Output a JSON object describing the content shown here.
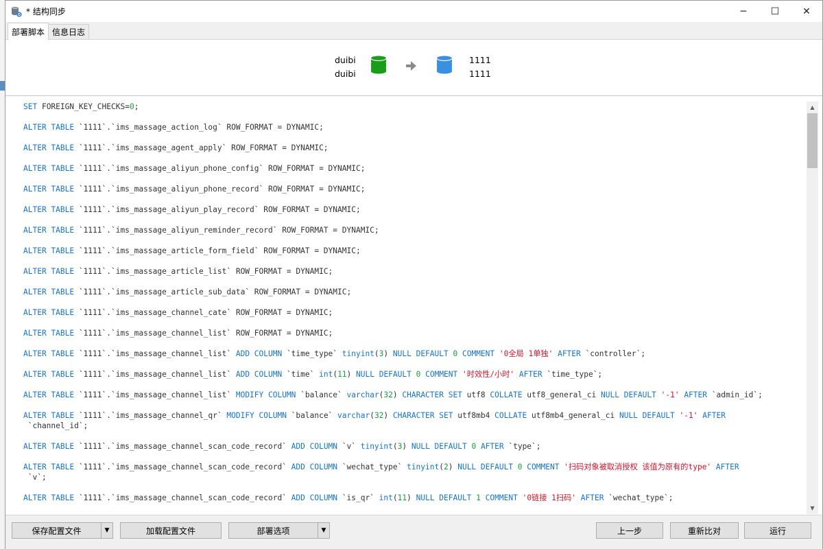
{
  "window": {
    "title": "* 结构同步",
    "icon": "database-sync-icon",
    "minimize_icon": "─",
    "maximize_icon": "☐",
    "close_icon": "✕"
  },
  "tabs": [
    {
      "label": "部署脚本",
      "active": true
    },
    {
      "label": "信息日志",
      "active": false
    }
  ],
  "header": {
    "source_connection": "duibi",
    "source_database": "duibi",
    "target_connection": "1111",
    "target_database": "1111",
    "source_color": "#1a9e1a",
    "target_color": "#3b8fe0"
  },
  "script_lines": [
    [
      {
        "t": "SET",
        "k": "kw"
      },
      {
        "t": " FOREIGN_KEY_CHECKS="
      },
      {
        "t": "0",
        "k": "num"
      },
      {
        "t": ";"
      }
    ],
    [
      {
        "t": "ALTER TABLE",
        "k": "kw"
      },
      {
        "t": " `1111`.`ims_massage_action_log` ROW_FORMAT = DYNAMIC;"
      }
    ],
    [
      {
        "t": "ALTER TABLE",
        "k": "kw"
      },
      {
        "t": " `1111`.`ims_massage_agent_apply` ROW_FORMAT = DYNAMIC;"
      }
    ],
    [
      {
        "t": "ALTER TABLE",
        "k": "kw"
      },
      {
        "t": " `1111`.`ims_massage_aliyun_phone_config` ROW_FORMAT = DYNAMIC;"
      }
    ],
    [
      {
        "t": "ALTER TABLE",
        "k": "kw"
      },
      {
        "t": " `1111`.`ims_massage_aliyun_phone_record` ROW_FORMAT = DYNAMIC;"
      }
    ],
    [
      {
        "t": "ALTER TABLE",
        "k": "kw"
      },
      {
        "t": " `1111`.`ims_massage_aliyun_play_record` ROW_FORMAT = DYNAMIC;"
      }
    ],
    [
      {
        "t": "ALTER TABLE",
        "k": "kw"
      },
      {
        "t": " `1111`.`ims_massage_aliyun_reminder_record` ROW_FORMAT = DYNAMIC;"
      }
    ],
    [
      {
        "t": "ALTER TABLE",
        "k": "kw"
      },
      {
        "t": " `1111`.`ims_massage_article_form_field` ROW_FORMAT = DYNAMIC;"
      }
    ],
    [
      {
        "t": "ALTER TABLE",
        "k": "kw"
      },
      {
        "t": " `1111`.`ims_massage_article_list` ROW_FORMAT = DYNAMIC;"
      }
    ],
    [
      {
        "t": "ALTER TABLE",
        "k": "kw"
      },
      {
        "t": " `1111`.`ims_massage_article_sub_data` ROW_FORMAT = DYNAMIC;"
      }
    ],
    [
      {
        "t": "ALTER TABLE",
        "k": "kw"
      },
      {
        "t": " `1111`.`ims_massage_channel_cate` ROW_FORMAT = DYNAMIC;"
      }
    ],
    [
      {
        "t": "ALTER TABLE",
        "k": "kw"
      },
      {
        "t": " `1111`.`ims_massage_channel_list` ROW_FORMAT = DYNAMIC;"
      }
    ],
    [
      {
        "t": "ALTER TABLE",
        "k": "kw"
      },
      {
        "t": " `1111`.`ims_massage_channel_list` "
      },
      {
        "t": "ADD COLUMN",
        "k": "kw"
      },
      {
        "t": " `time_type` "
      },
      {
        "t": "tinyint",
        "k": "kw"
      },
      {
        "t": "("
      },
      {
        "t": "3",
        "k": "num"
      },
      {
        "t": ") "
      },
      {
        "t": "NULL DEFAULT",
        "k": "kw"
      },
      {
        "t": " "
      },
      {
        "t": "0",
        "k": "num"
      },
      {
        "t": " "
      },
      {
        "t": "COMMENT",
        "k": "kw"
      },
      {
        "t": " "
      },
      {
        "t": "'0全局 1单独'",
        "k": "str"
      },
      {
        "t": " "
      },
      {
        "t": "AFTER",
        "k": "kw"
      },
      {
        "t": " `controller`;"
      }
    ],
    [
      {
        "t": "ALTER TABLE",
        "k": "kw"
      },
      {
        "t": " `1111`.`ims_massage_channel_list` "
      },
      {
        "t": "ADD COLUMN",
        "k": "kw"
      },
      {
        "t": " `time` "
      },
      {
        "t": "int",
        "k": "kw"
      },
      {
        "t": "("
      },
      {
        "t": "11",
        "k": "num"
      },
      {
        "t": ") "
      },
      {
        "t": "NULL DEFAULT",
        "k": "kw"
      },
      {
        "t": " "
      },
      {
        "t": "0",
        "k": "num"
      },
      {
        "t": " "
      },
      {
        "t": "COMMENT",
        "k": "kw"
      },
      {
        "t": " "
      },
      {
        "t": "'时效性/小时'",
        "k": "str"
      },
      {
        "t": " "
      },
      {
        "t": "AFTER",
        "k": "kw"
      },
      {
        "t": " `time_type`;"
      }
    ],
    [
      {
        "t": "ALTER TABLE",
        "k": "kw"
      },
      {
        "t": " `1111`.`ims_massage_channel_list` "
      },
      {
        "t": "MODIFY COLUMN",
        "k": "kw"
      },
      {
        "t": " `balance` "
      },
      {
        "t": "varchar",
        "k": "kw"
      },
      {
        "t": "("
      },
      {
        "t": "32",
        "k": "num"
      },
      {
        "t": ") "
      },
      {
        "t": "CHARACTER SET",
        "k": "kw"
      },
      {
        "t": " utf8 "
      },
      {
        "t": "COLLATE",
        "k": "kw"
      },
      {
        "t": " utf8_general_ci "
      },
      {
        "t": "NULL DEFAULT",
        "k": "kw"
      },
      {
        "t": " "
      },
      {
        "t": "'-1'",
        "k": "str"
      },
      {
        "t": " "
      },
      {
        "t": "AFTER",
        "k": "kw"
      },
      {
        "t": " `admin_id`;"
      }
    ],
    [
      {
        "t": "ALTER TABLE",
        "k": "kw"
      },
      {
        "t": " `1111`.`ims_massage_channel_qr` "
      },
      {
        "t": "MODIFY COLUMN",
        "k": "kw"
      },
      {
        "t": " `balance` "
      },
      {
        "t": "varchar",
        "k": "kw"
      },
      {
        "t": "("
      },
      {
        "t": "32",
        "k": "num"
      },
      {
        "t": ") "
      },
      {
        "t": "CHARACTER SET",
        "k": "kw"
      },
      {
        "t": " utf8mb4 "
      },
      {
        "t": "COLLATE",
        "k": "kw"
      },
      {
        "t": " utf8mb4_general_ci "
      },
      {
        "t": "NULL DEFAULT",
        "k": "kw"
      },
      {
        "t": " "
      },
      {
        "t": "'-1'",
        "k": "str"
      },
      {
        "t": " "
      },
      {
        "t": "AFTER",
        "k": "kw"
      },
      {
        "t": "\n `channel_id`;"
      }
    ],
    [
      {
        "t": "ALTER TABLE",
        "k": "kw"
      },
      {
        "t": " `1111`.`ims_massage_channel_scan_code_record` "
      },
      {
        "t": "ADD COLUMN",
        "k": "kw"
      },
      {
        "t": " `v` "
      },
      {
        "t": "tinyint",
        "k": "kw"
      },
      {
        "t": "("
      },
      {
        "t": "3",
        "k": "num"
      },
      {
        "t": ") "
      },
      {
        "t": "NULL DEFAULT",
        "k": "kw"
      },
      {
        "t": " "
      },
      {
        "t": "0",
        "k": "num"
      },
      {
        "t": " "
      },
      {
        "t": "AFTER",
        "k": "kw"
      },
      {
        "t": " `type`;"
      }
    ],
    [
      {
        "t": "ALTER TABLE",
        "k": "kw"
      },
      {
        "t": " `1111`.`ims_massage_channel_scan_code_record` "
      },
      {
        "t": "ADD COLUMN",
        "k": "kw"
      },
      {
        "t": " `wechat_type` "
      },
      {
        "t": "tinyint",
        "k": "kw"
      },
      {
        "t": "("
      },
      {
        "t": "2",
        "k": "num"
      },
      {
        "t": ") "
      },
      {
        "t": "NULL DEFAULT",
        "k": "kw"
      },
      {
        "t": " "
      },
      {
        "t": "0",
        "k": "num"
      },
      {
        "t": " "
      },
      {
        "t": "COMMENT",
        "k": "kw"
      },
      {
        "t": " "
      },
      {
        "t": "'扫码对象被取消授权 该值为原有的type'",
        "k": "str"
      },
      {
        "t": " "
      },
      {
        "t": "AFTER",
        "k": "kw"
      },
      {
        "t": "\n `v`;"
      }
    ],
    [
      {
        "t": "ALTER TABLE",
        "k": "kw"
      },
      {
        "t": " `1111`.`ims_massage_channel_scan_code_record` "
      },
      {
        "t": "ADD COLUMN",
        "k": "kw"
      },
      {
        "t": " `is_qr` "
      },
      {
        "t": "int",
        "k": "kw"
      },
      {
        "t": "("
      },
      {
        "t": "11",
        "k": "num"
      },
      {
        "t": ") "
      },
      {
        "t": "NULL DEFAULT",
        "k": "kw"
      },
      {
        "t": " "
      },
      {
        "t": "1",
        "k": "num"
      },
      {
        "t": " "
      },
      {
        "t": "COMMENT",
        "k": "kw"
      },
      {
        "t": " "
      },
      {
        "t": "'0链接 1扫码'",
        "k": "str"
      },
      {
        "t": " "
      },
      {
        "t": "AFTER",
        "k": "kw"
      },
      {
        "t": " `wechat_type`;"
      }
    ]
  ],
  "scrollbar": {
    "up_icon": "▲",
    "down_icon": "▼"
  },
  "footer": {
    "save_config": "保存配置文件",
    "load_config": "加载配置文件",
    "deploy_options": "部署选项",
    "prev_step": "上一步",
    "recompare": "重新比对",
    "run": "运行",
    "dropdown_icon": "▼"
  }
}
